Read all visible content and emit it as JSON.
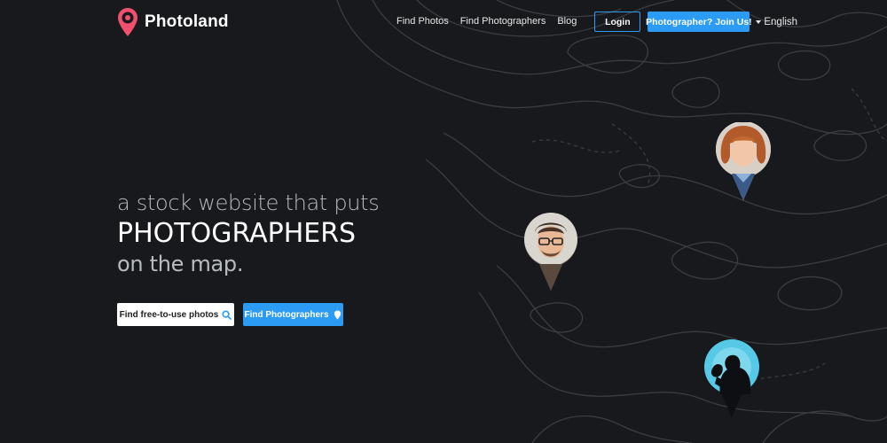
{
  "brand": {
    "name": "Photoland",
    "accent": "#f0506e"
  },
  "nav": {
    "links": [
      "Find Photos",
      "Find Photographers",
      "Blog"
    ],
    "login_label": "Login",
    "join_label": "Photographer? Join Us!",
    "language": "English"
  },
  "hero": {
    "line1": "a stock website that puts",
    "line2": "PHOTOGRAPHERS",
    "line3": "on the map."
  },
  "cta": {
    "photos_label": "Find free-to-use photos",
    "photos_icon": "search-icon",
    "photographers_label": "Find Photographers",
    "photographers_icon": "map-pin-icon"
  },
  "colors": {
    "background": "#17191c",
    "primary": "#2b9bf4",
    "login_border": "#2f9bff"
  },
  "map_pins": [
    "photographer-pin-woman",
    "photographer-pin-man",
    "photographer-pin-silhouette"
  ]
}
